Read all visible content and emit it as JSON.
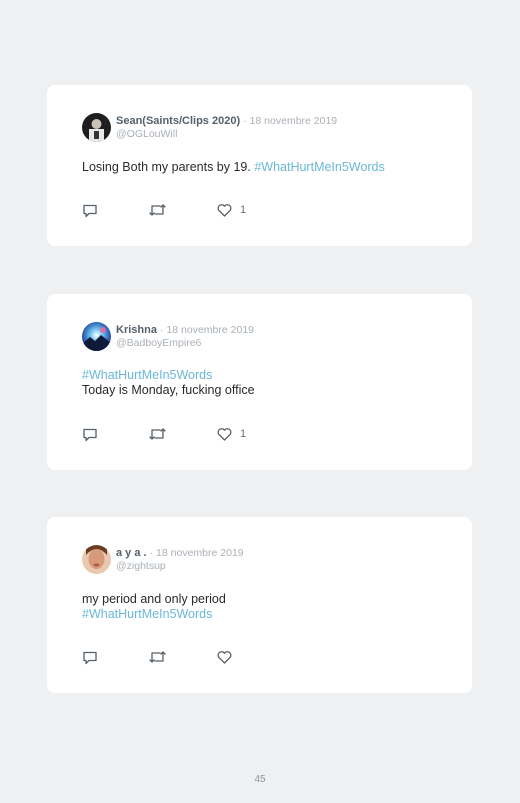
{
  "tweets": [
    {
      "name": "Sean(Saints/Clips 2020)",
      "date": "· 18 novembre 2019",
      "handle": "@OGLouWill",
      "text_before": "Losing Both my parents by 19. ",
      "hashtag": "#WhatHurtMeIn5Words",
      "text_after": "",
      "likes": "1",
      "avatar_icon": "avatar-photo-person",
      "colors": {
        "avatar": "#2b2b2b"
      }
    },
    {
      "name": "Krishna",
      "date": "· 18 novembre 2019",
      "handle": "@BadboyEmpire6",
      "hashtag": "#WhatHurtMeIn5Words",
      "text_after": "Today is Monday, fucking office",
      "likes": "1",
      "avatar_icon": "avatar-photo-galaxy"
    },
    {
      "name": "a y a .",
      "date": "· 18 novembre 2019",
      "handle": "@zightsup",
      "text_before": "my period and only period",
      "hashtag": "#WhatHurtMeIn5Words",
      "likes": "",
      "avatar_icon": "avatar-photo-woman"
    }
  ],
  "icons": [
    "reply-icon",
    "retweet-icon",
    "heart-icon"
  ],
  "colors": {
    "hashtag": "#6ab7d8",
    "name": "#55606b",
    "muted": "#a9b0b7",
    "background": "#eef0f2"
  },
  "page_number": "45"
}
